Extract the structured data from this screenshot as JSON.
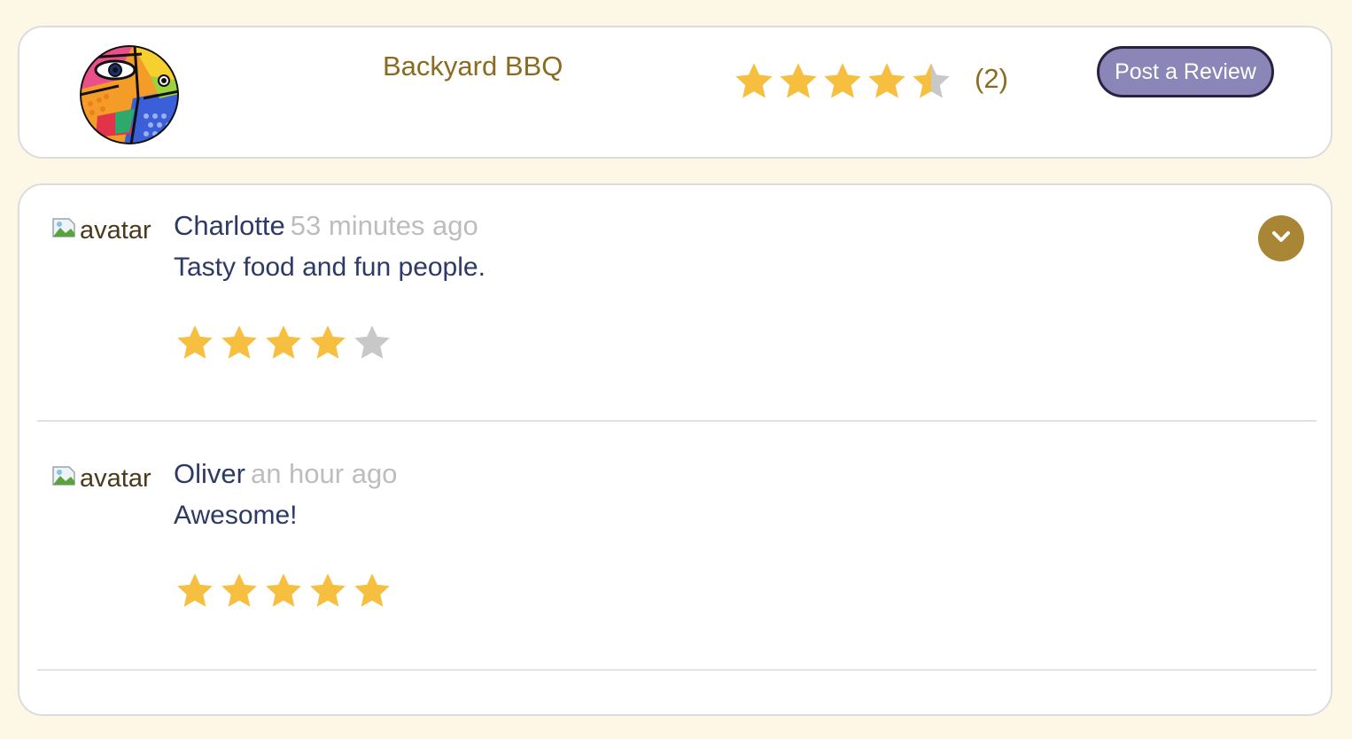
{
  "business": {
    "name": "Backyard BBQ",
    "rating": 4.5,
    "review_count": "(2)",
    "post_button": "Post a Review"
  },
  "colors": {
    "star_filled": "#f6bf3f",
    "star_empty": "#c8c8c8",
    "accent": "#a88636",
    "button_bg": "#8a86b8"
  },
  "reviews": [
    {
      "avatar_alt": "avatar",
      "name": "Charlotte",
      "time": "53 minutes ago",
      "text": "Tasty food and fun people.",
      "rating": 4
    },
    {
      "avatar_alt": "avatar",
      "name": "Oliver",
      "time": "an hour ago",
      "text": "Awesome!",
      "rating": 5
    }
  ],
  "icons": {
    "expand": "chevron-down-icon",
    "star": "star-icon",
    "logo": "business-logo"
  }
}
